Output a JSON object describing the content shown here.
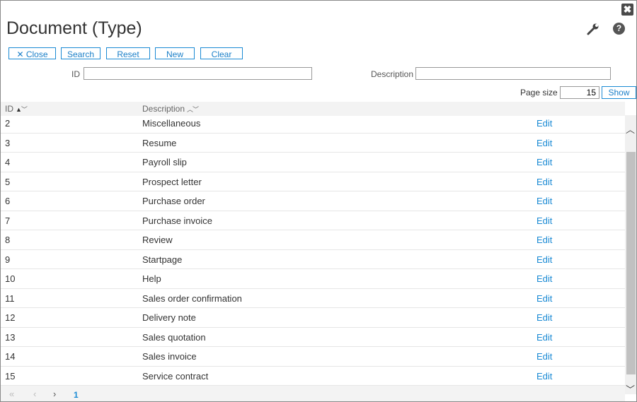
{
  "window": {
    "close_glyph": "✖"
  },
  "page": {
    "title": "Document (Type)"
  },
  "toolbar": {
    "close_label": "Close",
    "search_label": "Search",
    "reset_label": "Reset",
    "new_label": "New",
    "clear_label": "Clear"
  },
  "filters": {
    "id_label": "ID",
    "id_value": "",
    "description_label": "Description",
    "description_value": "",
    "page_size_label": "Page size",
    "page_size_value": "15",
    "show_label": "Show"
  },
  "table": {
    "columns": {
      "id": "ID",
      "description": "Description"
    },
    "rows": [
      {
        "id": "2",
        "description": "Miscellaneous",
        "action": "Edit"
      },
      {
        "id": "3",
        "description": "Resume",
        "action": "Edit"
      },
      {
        "id": "4",
        "description": "Payroll slip",
        "action": "Edit"
      },
      {
        "id": "5",
        "description": "Prospect letter",
        "action": "Edit"
      },
      {
        "id": "6",
        "description": "Purchase order",
        "action": "Edit"
      },
      {
        "id": "7",
        "description": "Purchase invoice",
        "action": "Edit"
      },
      {
        "id": "8",
        "description": "Review",
        "action": "Edit"
      },
      {
        "id": "9",
        "description": "Startpage",
        "action": "Edit"
      },
      {
        "id": "10",
        "description": "Help",
        "action": "Edit"
      },
      {
        "id": "11",
        "description": "Sales order confirmation",
        "action": "Edit"
      },
      {
        "id": "12",
        "description": "Delivery note",
        "action": "Edit"
      },
      {
        "id": "13",
        "description": "Sales quotation",
        "action": "Edit"
      },
      {
        "id": "14",
        "description": "Sales invoice",
        "action": "Edit"
      },
      {
        "id": "15",
        "description": "Service contract",
        "action": "Edit"
      }
    ]
  },
  "pager": {
    "current_page": "1"
  },
  "icons": {
    "close_window": "close-icon",
    "settings": "wrench-icon",
    "help": "help-icon",
    "close_button": "x-icon"
  },
  "colors": {
    "accent": "#1a8ad4",
    "header_bg": "#f3f3f3"
  }
}
